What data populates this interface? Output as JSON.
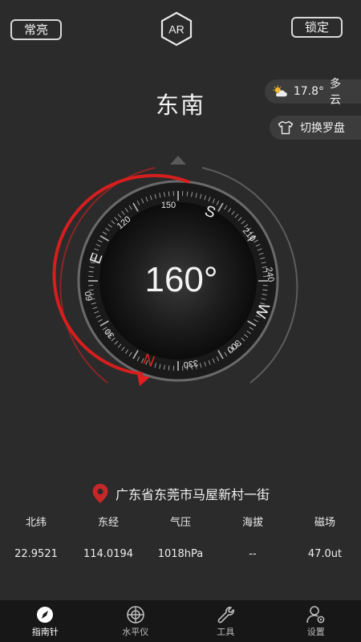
{
  "header": {
    "always_on_label": "常亮",
    "ar_label": "AR",
    "lock_label": "锁定"
  },
  "direction_title": "东南",
  "weather": {
    "icon": "partly-cloudy-icon",
    "temperature": "17.8°",
    "condition": "多云"
  },
  "switch_dial": {
    "icon": "shirt-icon",
    "label": "切换罗盘"
  },
  "compass": {
    "heading_deg": 160,
    "heading_text": "160°",
    "cardinals": [
      "N",
      "E",
      "S",
      "W"
    ],
    "numbers": [
      "30",
      "60",
      "120",
      "150",
      "210",
      "240",
      "300",
      "330"
    ],
    "accent_color": "#e02020"
  },
  "location": {
    "icon": "map-pin-icon",
    "address": "广东省东莞市马屋新村一街"
  },
  "info": {
    "labels": [
      "北纬",
      "东经",
      "气压",
      "海拔",
      "磁场"
    ],
    "values": [
      "22.9521",
      "114.0194",
      "1018hPa",
      "--",
      "47.0ut"
    ]
  },
  "nav": {
    "items": [
      {
        "label": "指南针",
        "icon": "compass-icon",
        "active": true
      },
      {
        "label": "水平仪",
        "icon": "level-icon",
        "active": false
      },
      {
        "label": "工具",
        "icon": "wrench-icon",
        "active": false
      },
      {
        "label": "设置",
        "icon": "settings-user-icon",
        "active": false
      }
    ]
  }
}
